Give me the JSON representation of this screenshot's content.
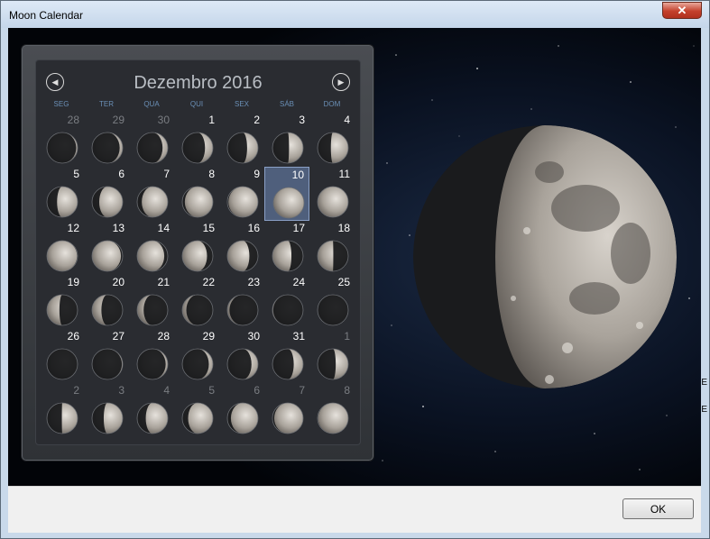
{
  "window": {
    "title": "Moon Calendar",
    "close_glyph": "✕"
  },
  "calendar": {
    "month_title": "Dezembro 2016",
    "prev_icon": "◀",
    "next_icon": "▶",
    "weekdays": [
      "SEG",
      "TER",
      "QUA",
      "QUI",
      "SEX",
      "SÁB",
      "DOM"
    ],
    "selected_day": 10,
    "weeks": [
      [
        {
          "d": "28",
          "o": true
        },
        {
          "d": "29",
          "o": true
        },
        {
          "d": "30",
          "o": true
        },
        {
          "d": "1"
        },
        {
          "d": "2"
        },
        {
          "d": "3"
        },
        {
          "d": "4"
        }
      ],
      [
        {
          "d": "5"
        },
        {
          "d": "6"
        },
        {
          "d": "7"
        },
        {
          "d": "8"
        },
        {
          "d": "9"
        },
        {
          "d": "10",
          "s": true
        },
        {
          "d": "11"
        }
      ],
      [
        {
          "d": "12"
        },
        {
          "d": "13"
        },
        {
          "d": "14"
        },
        {
          "d": "15"
        },
        {
          "d": "16"
        },
        {
          "d": "17"
        },
        {
          "d": "18"
        }
      ],
      [
        {
          "d": "19"
        },
        {
          "d": "20"
        },
        {
          "d": "21"
        },
        {
          "d": "22"
        },
        {
          "d": "23"
        },
        {
          "d": "24"
        },
        {
          "d": "25"
        }
      ],
      [
        {
          "d": "26"
        },
        {
          "d": "27"
        },
        {
          "d": "28"
        },
        {
          "d": "29"
        },
        {
          "d": "30"
        },
        {
          "d": "31"
        },
        {
          "d": "1",
          "o": true
        }
      ],
      [
        {
          "d": "2",
          "o": true
        },
        {
          "d": "3",
          "o": true
        },
        {
          "d": "4",
          "o": true
        },
        {
          "d": "5",
          "o": true
        },
        {
          "d": "6",
          "o": true
        },
        {
          "d": "7",
          "o": true
        },
        {
          "d": "8",
          "o": true
        }
      ]
    ]
  },
  "footer": {
    "ok_label": "OK"
  },
  "colors": {
    "accent": "#6a8fb6",
    "selected_bg": "#4f5f7c",
    "panel_bg": "#2a2c31"
  }
}
